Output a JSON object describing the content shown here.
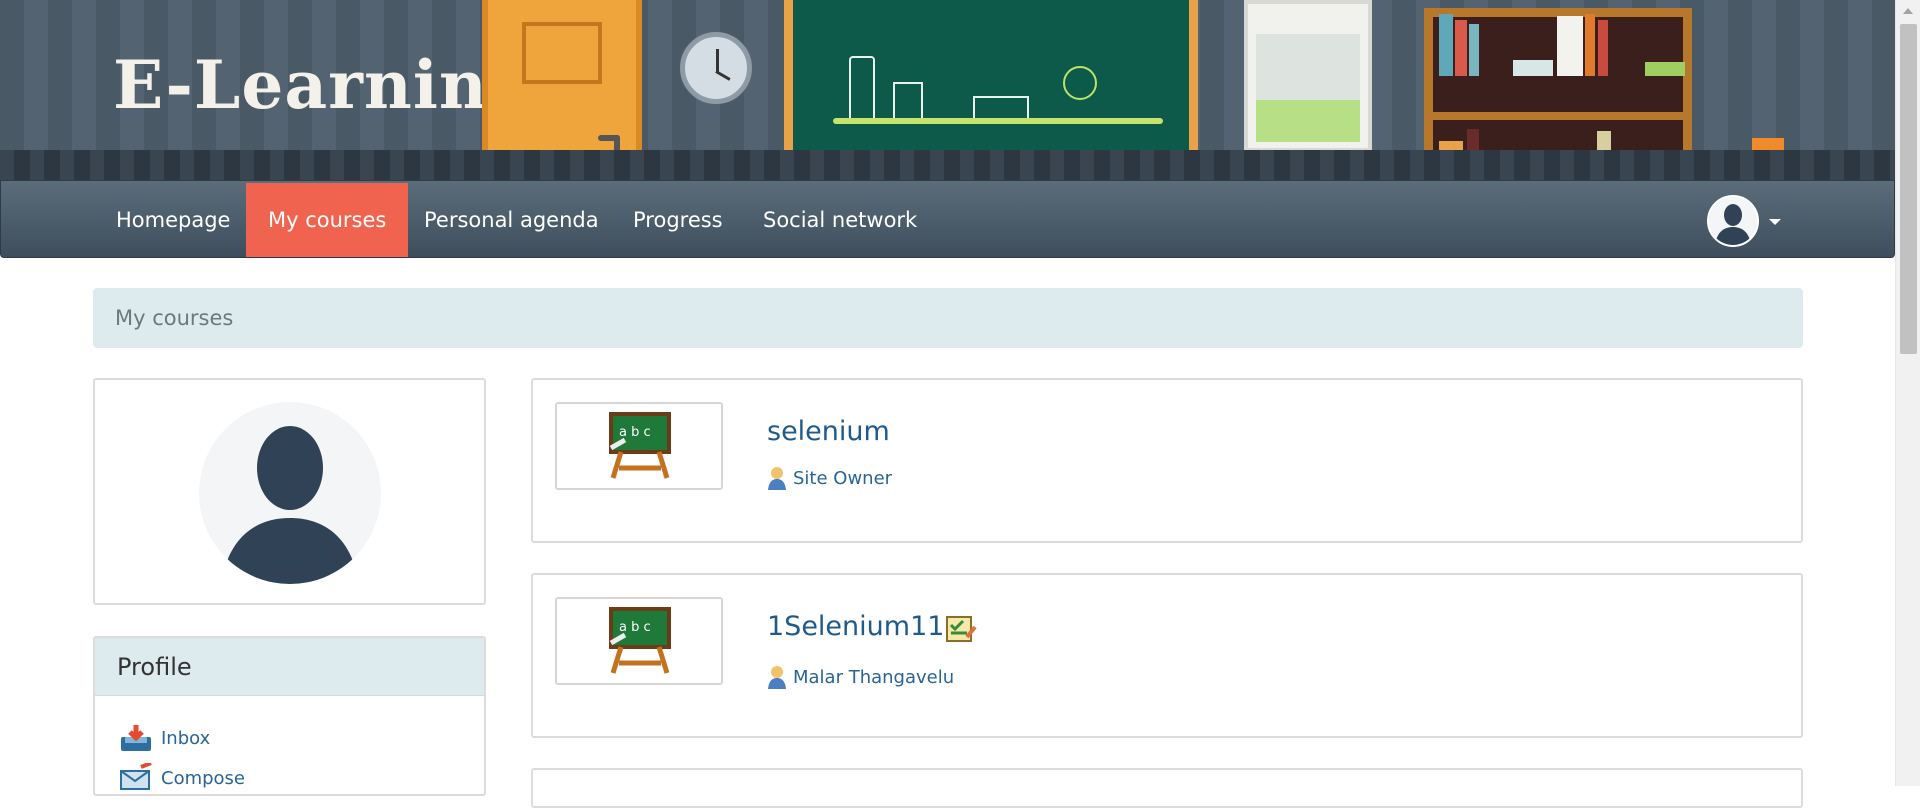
{
  "app": {
    "logo_text": "E-Learning"
  },
  "nav": {
    "items": [
      {
        "label": "Homepage"
      },
      {
        "label": "My courses"
      },
      {
        "label": "Personal agenda"
      },
      {
        "label": "Progress"
      },
      {
        "label": "Social network"
      }
    ],
    "active": "My courses",
    "user_menu_icon": "avatar-icon",
    "caret_icon": "caret-down-icon"
  },
  "breadcrumb": {
    "label": "My courses"
  },
  "profile": {
    "avatar_icon": "user-silhouette-icon",
    "panel_title": "Profile",
    "links": [
      {
        "label": "Inbox",
        "icon": "inbox-icon"
      },
      {
        "label": "Compose",
        "icon": "compose-icon"
      }
    ]
  },
  "courses": [
    {
      "title": "selenium",
      "teacher": "Site Owner",
      "thumb_icon": "chalkboard-icon",
      "teacher_icon": "user-icon"
    },
    {
      "title": "1Selenium11",
      "teacher": "Malar Thangavelu",
      "thumb_icon": "chalkboard-icon",
      "teacher_icon": "user-icon",
      "badge_icon": "checklist-icon"
    }
  ],
  "colors": {
    "nav_bg": "#4a5a68",
    "nav_active": "#f0634e",
    "breadcrumb_bg": "#deebee",
    "link": "#2a6496",
    "course_title": "#1f5a8a"
  }
}
